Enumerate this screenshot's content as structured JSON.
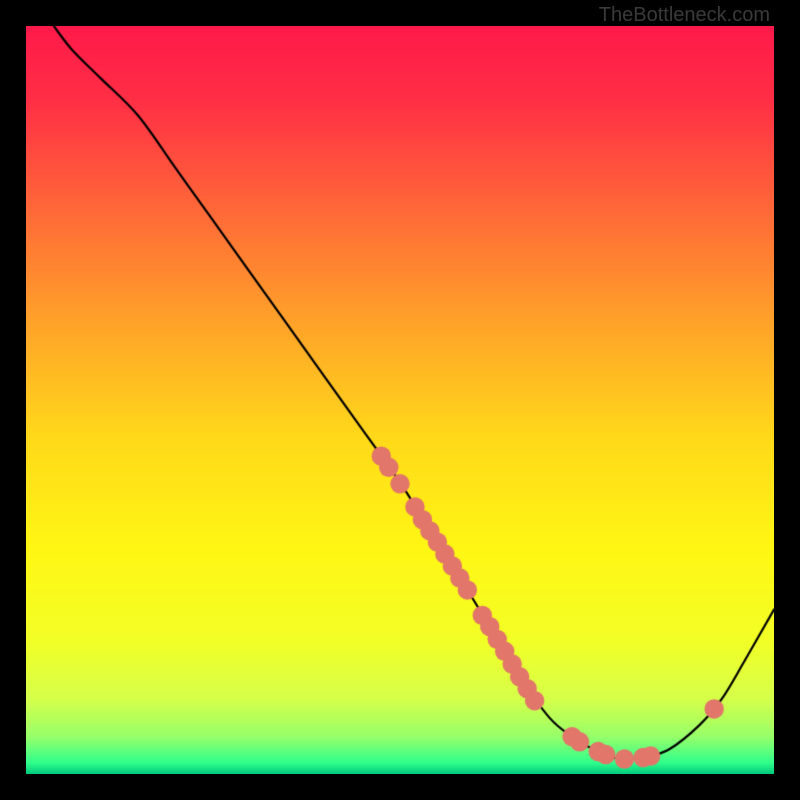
{
  "watermark": "TheBottleneck.com",
  "chart_data": {
    "type": "line",
    "title": "",
    "xlabel": "",
    "ylabel": "",
    "xlim": [
      0,
      100
    ],
    "ylim": [
      0,
      100
    ],
    "grid": false,
    "legend": false,
    "series": [
      {
        "name": "curve",
        "color": "#000000",
        "x": [
          0,
          3,
          6,
          10,
          15,
          20,
          25,
          30,
          35,
          40,
          45,
          50,
          55,
          60,
          63,
          66,
          70,
          73,
          76,
          78,
          80,
          83,
          86,
          90,
          93,
          96,
          100
        ],
        "y": [
          105,
          101,
          97,
          93,
          88,
          81,
          74,
          67,
          60,
          53,
          46,
          39,
          31,
          23,
          18,
          13,
          7.5,
          5,
          3.2,
          2.3,
          2.0,
          2.3,
          3.3,
          6.5,
          10,
          15,
          22
        ]
      }
    ],
    "points": {
      "name": "markers",
      "color": "#e2766a",
      "radius": 1.3,
      "xy": [
        [
          47.5,
          42.5
        ],
        [
          48.5,
          41.0
        ],
        [
          50.0,
          38.8
        ],
        [
          52.0,
          35.7
        ],
        [
          53.0,
          34.0
        ],
        [
          54.0,
          32.5
        ],
        [
          55.0,
          31.0
        ],
        [
          56.0,
          29.4
        ],
        [
          57.0,
          27.8
        ],
        [
          58.0,
          26.2
        ],
        [
          59.0,
          24.6
        ],
        [
          61.0,
          21.2
        ],
        [
          62.0,
          19.7
        ],
        [
          63.0,
          18.0
        ],
        [
          64.0,
          16.4
        ],
        [
          65.0,
          14.7
        ],
        [
          66.0,
          13.0
        ],
        [
          67.0,
          11.4
        ],
        [
          68.0,
          9.8
        ],
        [
          73.0,
          5.0
        ],
        [
          74.0,
          4.3
        ],
        [
          76.5,
          3.0
        ],
        [
          77.5,
          2.6
        ],
        [
          80.0,
          2.0
        ],
        [
          82.5,
          2.2
        ],
        [
          83.5,
          2.4
        ],
        [
          92.0,
          8.7
        ]
      ]
    },
    "background_gradient": {
      "type": "vertical",
      "stops": [
        {
          "pos": 0.0,
          "color": "#ff1a4a"
        },
        {
          "pos": 0.1,
          "color": "#ff2f45"
        },
        {
          "pos": 0.25,
          "color": "#ff6a38"
        },
        {
          "pos": 0.4,
          "color": "#ffa429"
        },
        {
          "pos": 0.55,
          "color": "#ffd91a"
        },
        {
          "pos": 0.7,
          "color": "#fff714"
        },
        {
          "pos": 0.82,
          "color": "#f3ff26"
        },
        {
          "pos": 0.9,
          "color": "#d6ff4a"
        },
        {
          "pos": 0.95,
          "color": "#97ff6a"
        },
        {
          "pos": 0.985,
          "color": "#30ff8c"
        },
        {
          "pos": 1.0,
          "color": "#00c97c"
        }
      ]
    }
  }
}
